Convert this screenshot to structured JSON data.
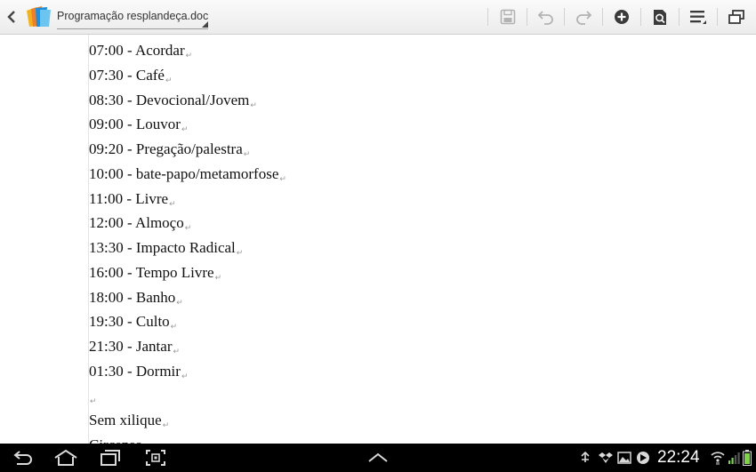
{
  "header": {
    "document_title": "Programação resplandeça.doc"
  },
  "toolbar": {
    "back_icon": "back-chevron-icon",
    "app_icon": "polaris-office-icon",
    "actions": [
      "save-icon",
      "undo-icon",
      "redo-icon",
      "insert-icon",
      "view-mode-icon",
      "menu-icon",
      "window-icon"
    ]
  },
  "document": {
    "lines": [
      "07:00 - Acordar",
      "07:30 - Café",
      "08:30 - Devocional/Jovem",
      "09:00 - Louvor",
      "09:20 - Pregação/palestra",
      "10:00 - bate-papo/metamorfose",
      "11:00 - Livre",
      "12:00 - Almoço",
      "13:30 - Impacto Radical",
      "16:00 - Tempo Livre",
      "18:00 - Banho",
      "19:30 - Culto",
      "21:30 - Jantar",
      "01:30 - Dormir",
      "",
      "Sem xilique",
      "Circenso"
    ],
    "paragraph_mark": "↵"
  },
  "system_bar": {
    "time": "22:24",
    "nav": [
      "back-icon",
      "home-icon",
      "recent-apps-icon",
      "screenshot-icon"
    ],
    "center": "app-drawer-up-icon",
    "status": [
      "usb-icon",
      "dropbox-icon",
      "gallery-icon",
      "media-icon",
      "wifi-icon",
      "signal-icon",
      "battery-icon"
    ]
  }
}
